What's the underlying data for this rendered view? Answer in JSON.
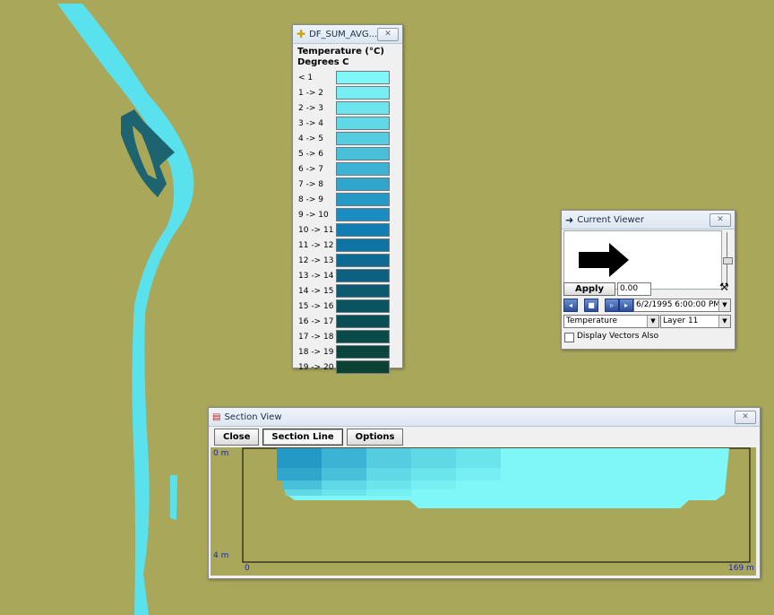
{
  "legend": {
    "title": "DF_SUM_AVG...",
    "close": "✕",
    "heading": "Temperature (°C)",
    "unit": "Degrees C",
    "entries": [
      {
        "label": "< 1",
        "color": "#7ff7f8"
      },
      {
        "label": "1 -> 2",
        "color": "#76eef2"
      },
      {
        "label": "2 -> 3",
        "color": "#6ce4ec"
      },
      {
        "label": "3 -> 4",
        "color": "#60d8e6"
      },
      {
        "label": "4 -> 5",
        "color": "#55cce0"
      },
      {
        "label": "5 -> 6",
        "color": "#48c0da"
      },
      {
        "label": "6 -> 7",
        "color": "#3cb3d4"
      },
      {
        "label": "7 -> 8",
        "color": "#30a6cd"
      },
      {
        "label": "8 -> 9",
        "color": "#2599c6"
      },
      {
        "label": "9 -> 10",
        "color": "#1a8cbf"
      },
      {
        "label": "10 -> 11",
        "color": "#127fb4"
      },
      {
        "label": "11 -> 12",
        "color": "#0e74a4"
      },
      {
        "label": "12 -> 13",
        "color": "#0d6a92"
      },
      {
        "label": "13 -> 14",
        "color": "#0c6180"
      },
      {
        "label": "14 -> 15",
        "color": "#0b5a70"
      },
      {
        "label": "15 -> 16",
        "color": "#0a5462"
      },
      {
        "label": "16 -> 17",
        "color": "#0a4e55"
      },
      {
        "label": "17 -> 18",
        "color": "#0a4a48"
      },
      {
        "label": "18 -> 19",
        "color": "#0a453d"
      },
      {
        "label": "19 -> 20",
        "color": "#0a4133"
      }
    ]
  },
  "viewer": {
    "title": "Current Viewer",
    "close": "✕",
    "apply": "Apply",
    "value": "0.00",
    "datetime": "6/2/1995 6:00:00 PM",
    "variable": "Temperature",
    "layer": "Layer 11",
    "vectors": "Display Vectors Also"
  },
  "section": {
    "title": "Section View",
    "close": "✕",
    "buttons": [
      "Close",
      "Section Line",
      "Options"
    ],
    "top_depth": "0 m",
    "bottom_depth": "4 m",
    "x_start": "0",
    "x_end": "169 m"
  }
}
